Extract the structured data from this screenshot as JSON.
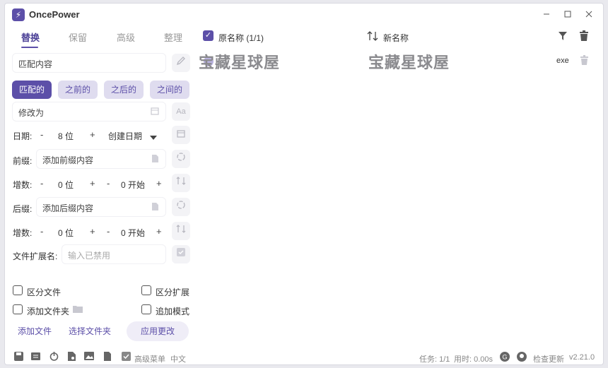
{
  "app": {
    "title": "OncePower",
    "logo_glyph": "⚡"
  },
  "tabs": [
    "替换",
    "保留",
    "高级",
    "整理"
  ],
  "match": {
    "input_value": "匹配内容",
    "modes": [
      "匹配的",
      "之前的",
      "之后的",
      "之间的"
    ],
    "active_mode": "匹配的",
    "replace_value": "修改为"
  },
  "date": {
    "label": "日期:",
    "minus": "-",
    "value": "8 位",
    "plus": "+",
    "type": "创建日期"
  },
  "prefix": {
    "label": "前缀:",
    "placeholder": "添加前缀内容"
  },
  "increment1": {
    "label": "增数:",
    "minus": "-",
    "digits": "0 位",
    "plus": "+",
    "minus2": "-",
    "start": "0 开始",
    "plus2": "+"
  },
  "suffix": {
    "label": "后缀:",
    "placeholder": "添加后缀内容"
  },
  "increment2": {
    "label": "增数:",
    "minus": "-",
    "digits": "0 位",
    "plus": "+",
    "minus2": "-",
    "start": "0 开始",
    "plus2": "+"
  },
  "extension": {
    "label": "文件扩展名:",
    "placeholder": "输入已禁用"
  },
  "options": {
    "distinguish_file": "区分文件",
    "distinguish_ext": "区分扩展",
    "add_folder": "添加文件夹",
    "append_mode": "追加模式"
  },
  "actions": {
    "add_file": "添加文件",
    "select_folder": "选择文件夹",
    "apply": "应用更改"
  },
  "list": {
    "header_original": "原名称 (1/1)",
    "header_new": "新名称",
    "rows": [
      {
        "original": "宝藏星球屋",
        "new": "宝藏星球屋",
        "ext": "exe"
      }
    ]
  },
  "status": {
    "advanced_menu": "高级菜单",
    "language": "中文",
    "tasks": "任务: 1/1",
    "time": "用时: 0.00s",
    "check_update": "检查更新",
    "version": "v2.21.0"
  },
  "colors": {
    "accent": "#5c4fa8",
    "accent_light": "#dfdcef"
  }
}
